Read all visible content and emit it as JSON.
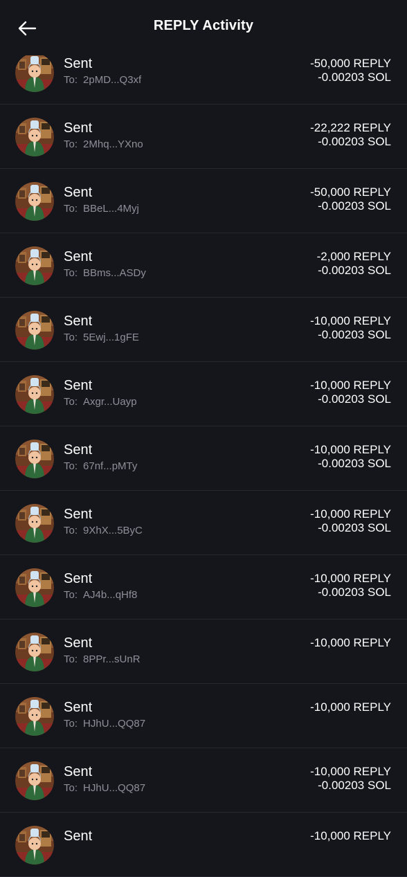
{
  "header": {
    "title": "REPLY Activity"
  },
  "rows": [
    {
      "status": "Sent",
      "to_label": "To:",
      "to": "2pMD...Q3xf",
      "token_amount": "-50,000 REPLY",
      "sol_amount": "-0.00203 SOL"
    },
    {
      "status": "Sent",
      "to_label": "To:",
      "to": "2Mhq...YXno",
      "token_amount": "-22,222 REPLY",
      "sol_amount": "-0.00203 SOL"
    },
    {
      "status": "Sent",
      "to_label": "To:",
      "to": "BBeL...4Myj",
      "token_amount": "-50,000 REPLY",
      "sol_amount": "-0.00203 SOL"
    },
    {
      "status": "Sent",
      "to_label": "To:",
      "to": "BBms...ASDy",
      "token_amount": "-2,000 REPLY",
      "sol_amount": "-0.00203 SOL"
    },
    {
      "status": "Sent",
      "to_label": "To:",
      "to": "5Ewj...1gFE",
      "token_amount": "-10,000 REPLY",
      "sol_amount": "-0.00203 SOL"
    },
    {
      "status": "Sent",
      "to_label": "To:",
      "to": "Axgr...Uayp",
      "token_amount": "-10,000 REPLY",
      "sol_amount": "-0.00203 SOL"
    },
    {
      "status": "Sent",
      "to_label": "To:",
      "to": "67nf...pMTy",
      "token_amount": "-10,000 REPLY",
      "sol_amount": "-0.00203 SOL"
    },
    {
      "status": "Sent",
      "to_label": "To:",
      "to": "9XhX...5ByC",
      "token_amount": "-10,000 REPLY",
      "sol_amount": "-0.00203 SOL"
    },
    {
      "status": "Sent",
      "to_label": "To:",
      "to": "AJ4b...qHf8",
      "token_amount": "-10,000 REPLY",
      "sol_amount": "-0.00203 SOL"
    },
    {
      "status": "Sent",
      "to_label": "To:",
      "to": "8PPr...sUnR",
      "token_amount": "-10,000 REPLY",
      "sol_amount": ""
    },
    {
      "status": "Sent",
      "to_label": "To:",
      "to": "HJhU...QQ87",
      "token_amount": "-10,000 REPLY",
      "sol_amount": ""
    },
    {
      "status": "Sent",
      "to_label": "To:",
      "to": "HJhU...QQ87",
      "token_amount": "-10,000 REPLY",
      "sol_amount": "-0.00203 SOL"
    },
    {
      "status": "Sent",
      "to_label": "",
      "to": "",
      "token_amount": "-10,000 REPLY",
      "sol_amount": ""
    }
  ]
}
